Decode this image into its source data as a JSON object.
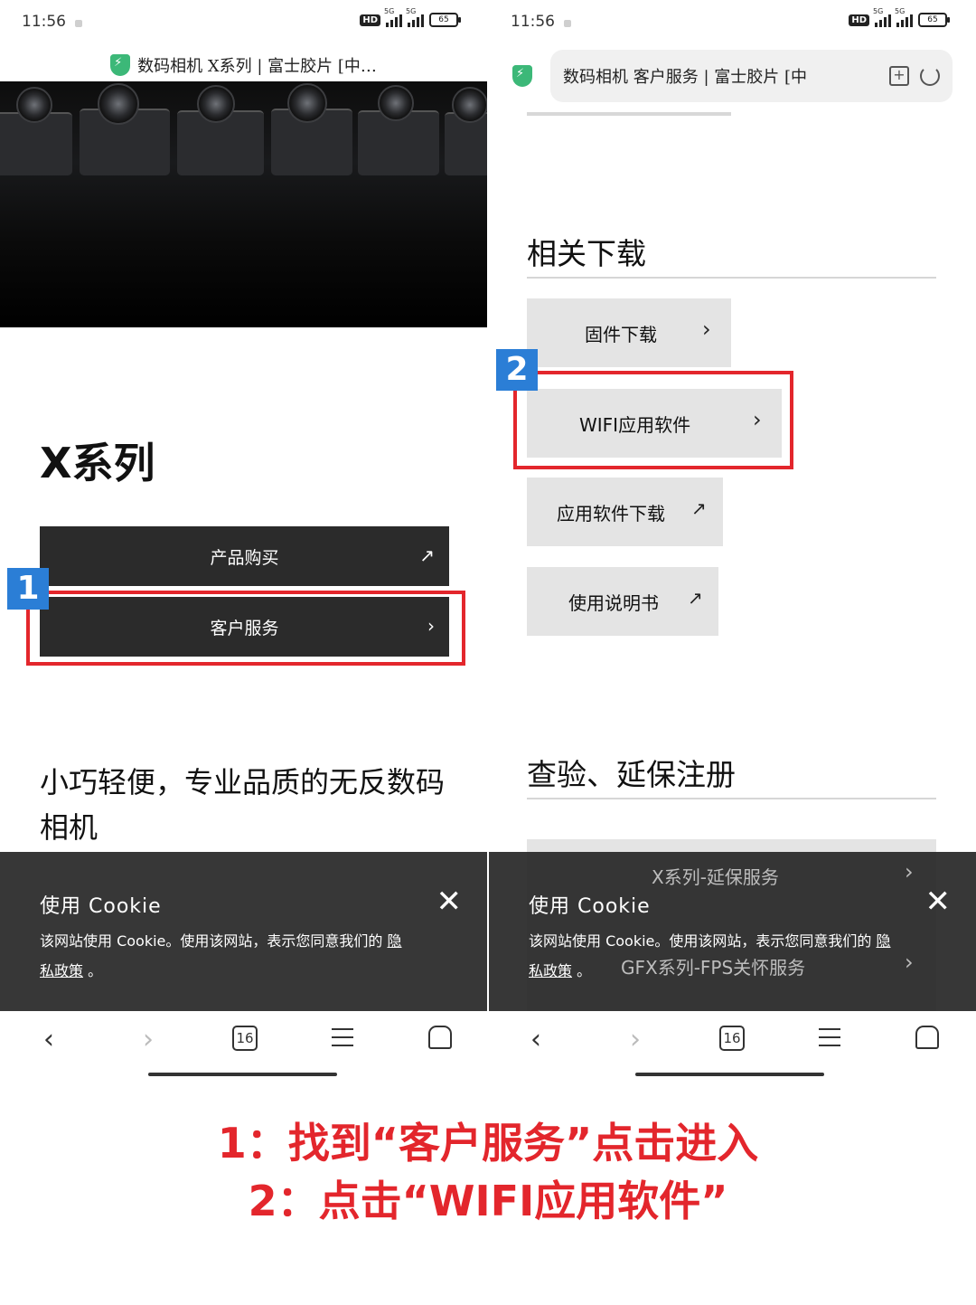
{
  "status_bar": {
    "time": "11:56",
    "net": "5G",
    "hd": "HD",
    "battery": "65"
  },
  "left": {
    "page_title": "数码相机 X系列 | 富士胶片 [中…",
    "heading": "X系列",
    "buttons": {
      "buy": "产品购买",
      "service": "客户服务"
    },
    "tagline": "小巧轻便，专业品质的无反数码相机",
    "badge": "1"
  },
  "right": {
    "page_title": "数码相机 客户服务 | 富士胶片 [中",
    "downloads": {
      "heading": "相关下载",
      "items": [
        "固件下载",
        "WIFI应用软件",
        "应用软件下载",
        "使用说明书"
      ]
    },
    "warranty": {
      "heading": "查验、延保注册",
      "items": [
        "X系列-延保服务",
        "GFX系列-FPS关怀服务"
      ]
    },
    "badge": "2"
  },
  "cookie": {
    "title": "使用 Cookie",
    "text": "该网站使用 Cookie。使用该网站，表示您同意我们的",
    "link_a": "隐",
    "link_b": "私政策",
    "tail": "。"
  },
  "nav": {
    "tab_count": "16"
  },
  "captions": {
    "line1": "1：找到“客户服务”点击进入",
    "line2": "2：点击“WIFI应用软件”"
  },
  "colors": {
    "annotation_red": "#e3262c",
    "badge_blue": "#2b7ed6",
    "dark_button": "#2b2b2b",
    "gray_button": "#e4e4e4"
  },
  "icons": [
    "shield-icon",
    "external-link-icon",
    "chevron-right-icon",
    "close-icon",
    "back-icon",
    "forward-icon",
    "tabs-icon",
    "menu-icon",
    "home-icon",
    "bookmark-add-icon",
    "reload-icon"
  ]
}
